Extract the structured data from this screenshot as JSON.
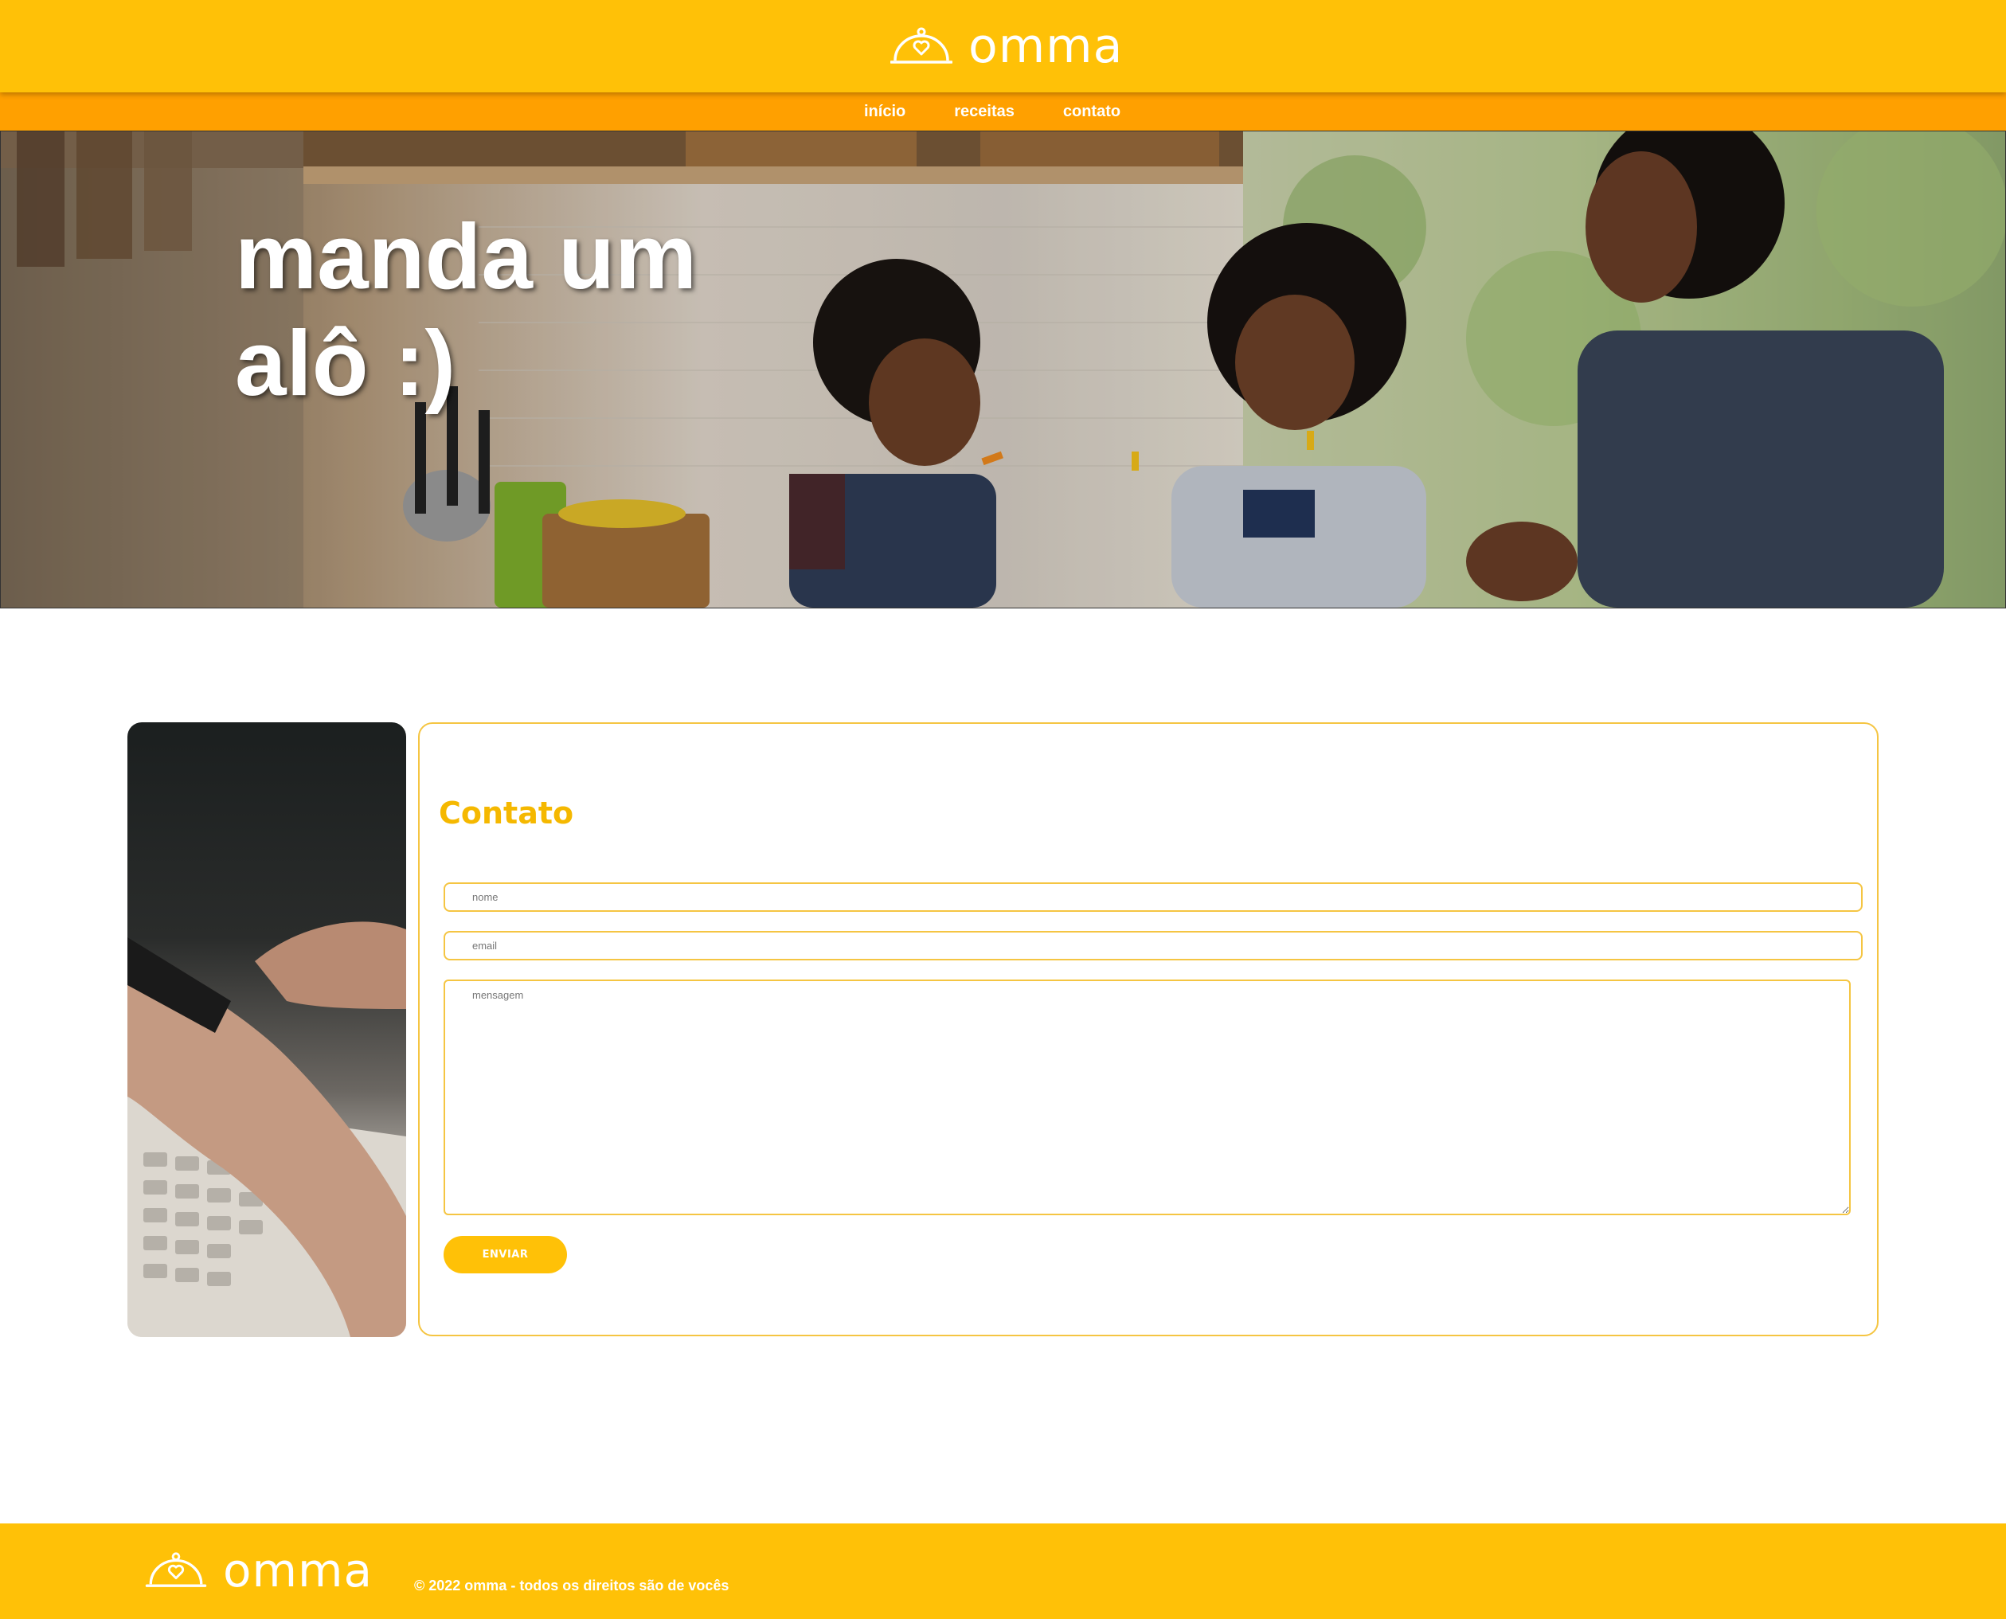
{
  "header": {
    "brand": "omma",
    "logo_icon": "cloche-heart-icon"
  },
  "nav": {
    "items": [
      {
        "label": "início"
      },
      {
        "label": "receitas"
      },
      {
        "label": "contato"
      }
    ]
  },
  "hero": {
    "title": "manda um alô :)"
  },
  "contact": {
    "title": "Contato",
    "name_placeholder": "nome",
    "email_placeholder": "email",
    "message_placeholder": "mensagem",
    "send_label": "ENVIAR"
  },
  "footer": {
    "brand": "omma",
    "copyright": "© 2022 omma - todos os direitos são de vocês"
  },
  "colors": {
    "header_yellow": "#ffc107",
    "nav_orange": "#ffa000",
    "accent_gold": "#f5b800",
    "border_gold": "#f5c542"
  }
}
